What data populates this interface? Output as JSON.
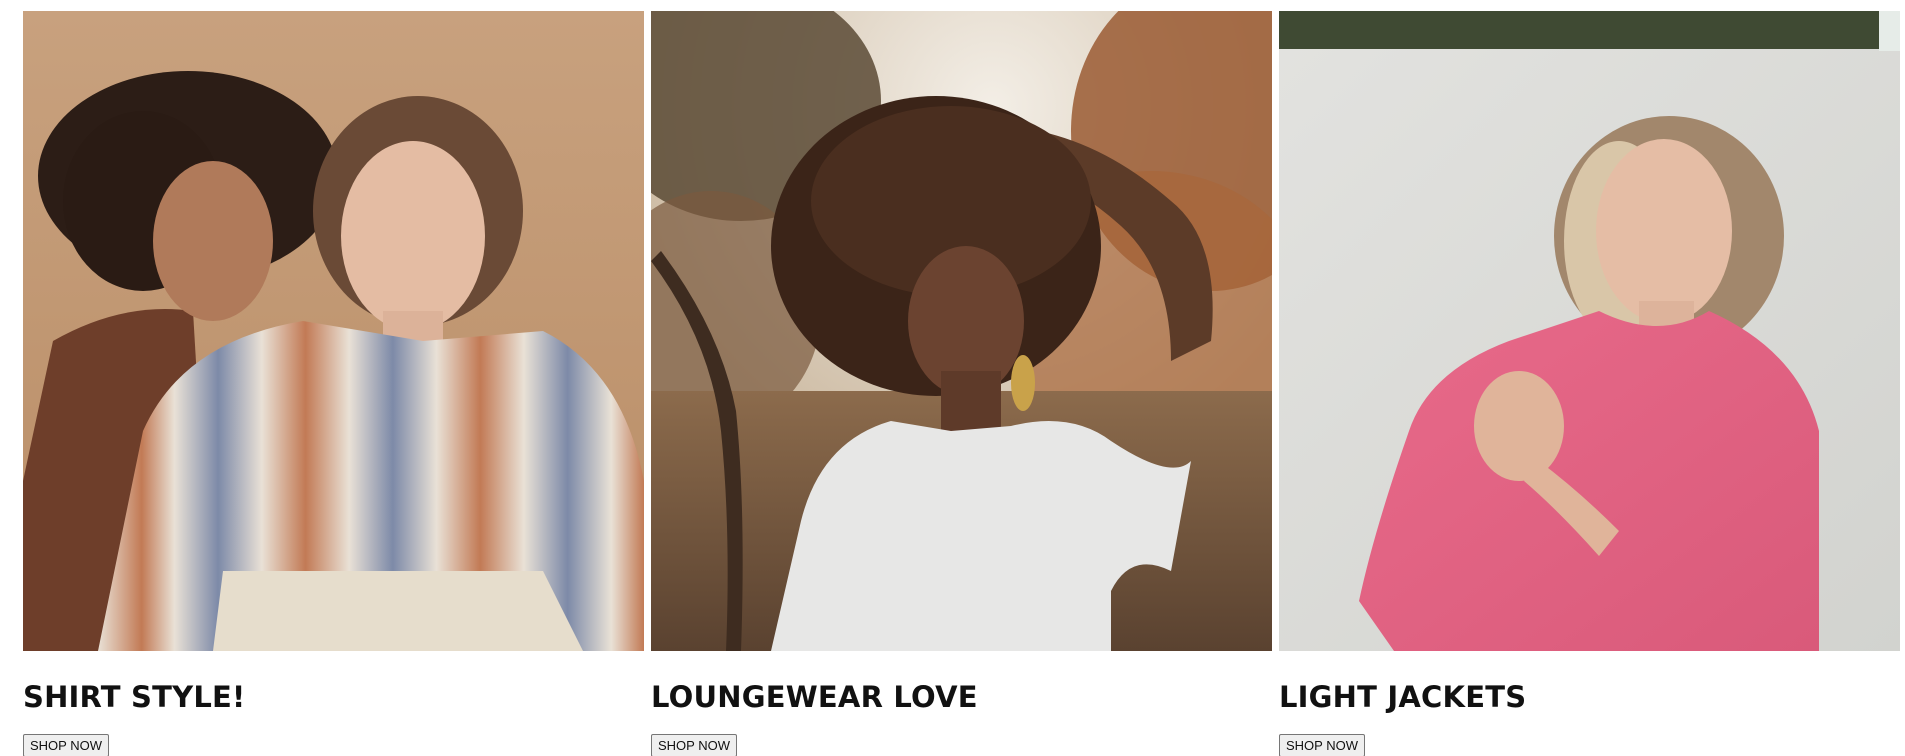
{
  "cards": [
    {
      "title": "SHIRT STYLE!",
      "button": "SHOP NOW",
      "image": "two-women-striped-shirt-photo"
    },
    {
      "title": "LOUNGEWEAR LOVE",
      "button": "SHOP NOW",
      "image": "woman-white-tee-autumn-leaves-photo"
    },
    {
      "title": "LIGHT JACKETS",
      "button": "SHOP NOW",
      "image": "woman-pink-jacket-photo"
    }
  ]
}
